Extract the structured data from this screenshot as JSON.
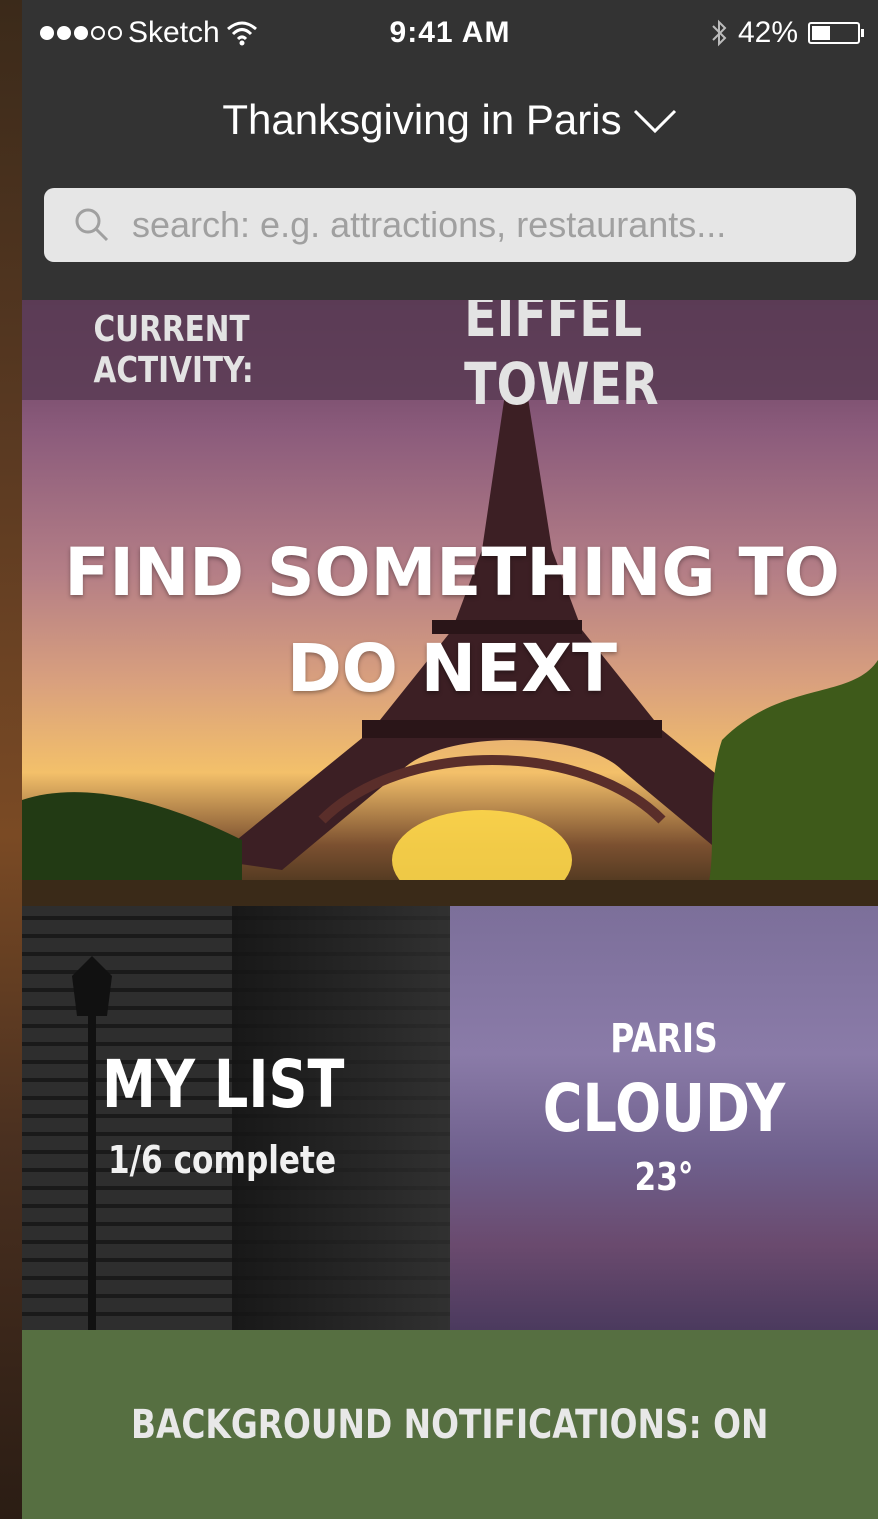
{
  "status_bar": {
    "carrier": "Sketch",
    "time": "9:41 AM",
    "battery_percent": "42%",
    "battery_level": 0.42,
    "signal_bars": 3,
    "icons": [
      "wifi-icon",
      "bluetooth-icon",
      "battery-icon"
    ]
  },
  "header": {
    "title": "Thanksgiving in Paris",
    "dropdown_icon": "chevron-down-icon"
  },
  "search": {
    "placeholder": "search: e.g. attractions, restaurants...",
    "icon": "search-icon"
  },
  "current_activity": {
    "label": "CURRENT ACTIVITY:",
    "value": "EIFFEL TOWER"
  },
  "hero": {
    "cta_line1": "FIND SOMETHING TO",
    "cta_line2": "DO NEXT"
  },
  "my_list": {
    "title": "MY LIST",
    "progress": "1/6 complete"
  },
  "weather": {
    "city": "PARIS",
    "condition": "CLOUDY",
    "temperature": "23°"
  },
  "notifications": {
    "label": "BACKGROUND NOTIFICATIONS:",
    "state": "ON"
  },
  "colors": {
    "app_bg": "#333333",
    "search_bg": "#e6e6e6",
    "notification_bg": "#566f41",
    "banner_bg": "#5a3c55"
  }
}
